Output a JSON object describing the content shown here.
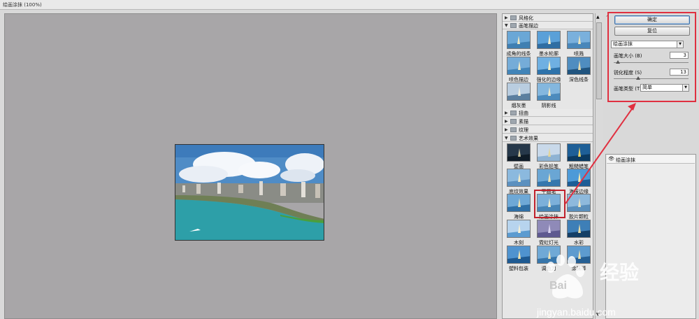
{
  "window": {
    "title": "绘画涂抹 (100%)"
  },
  "filter_gallery": {
    "categories": [
      {
        "name": "风格化",
        "expanded": false
      },
      {
        "name": "画笔描边",
        "expanded": true,
        "filters": [
          "成角的线条",
          "墨水轮廓",
          "喷溅",
          "喷色描边",
          "强化的边缘",
          "深色线条",
          "烟灰墨",
          "阴影线"
        ]
      },
      {
        "name": "扭曲",
        "expanded": false
      },
      {
        "name": "素描",
        "expanded": false
      },
      {
        "name": "纹理",
        "expanded": false
      },
      {
        "name": "艺术效果",
        "expanded": true,
        "filters": [
          "壁画",
          "彩色铅笔",
          "粗糙蜡笔",
          "底纹效果",
          "干画笔",
          "海报边缘",
          "海绵",
          "绘画涂抹",
          "胶片颗粒",
          "木刻",
          "霓虹灯光",
          "水彩",
          "塑料包装",
          "调色刀",
          "涂抹棒"
        ]
      }
    ],
    "selected_filter": "绘画涂抹"
  },
  "settings": {
    "ok_label": "确定",
    "reset_label": "复位",
    "filter_select": "绘画涂抹",
    "brush_size": {
      "label": "画笔大小 (B)",
      "value": "3",
      "level": 0.06
    },
    "sharpness": {
      "label": "锐化程度 (S)",
      "value": "13",
      "level": 0.33
    },
    "brush_type": {
      "label": "画笔类型 (T):",
      "value": "简单"
    }
  },
  "layers": {
    "items": [
      {
        "name": "绘画涂抹"
      }
    ]
  },
  "watermark": {
    "brand": "Bai",
    "text": "经验",
    "url": "jingyan.baidu.com"
  },
  "colors": {
    "canvas_bg": "#a8a6a8",
    "panel_bg": "#e6e6e6",
    "highlight": "#e03040"
  }
}
